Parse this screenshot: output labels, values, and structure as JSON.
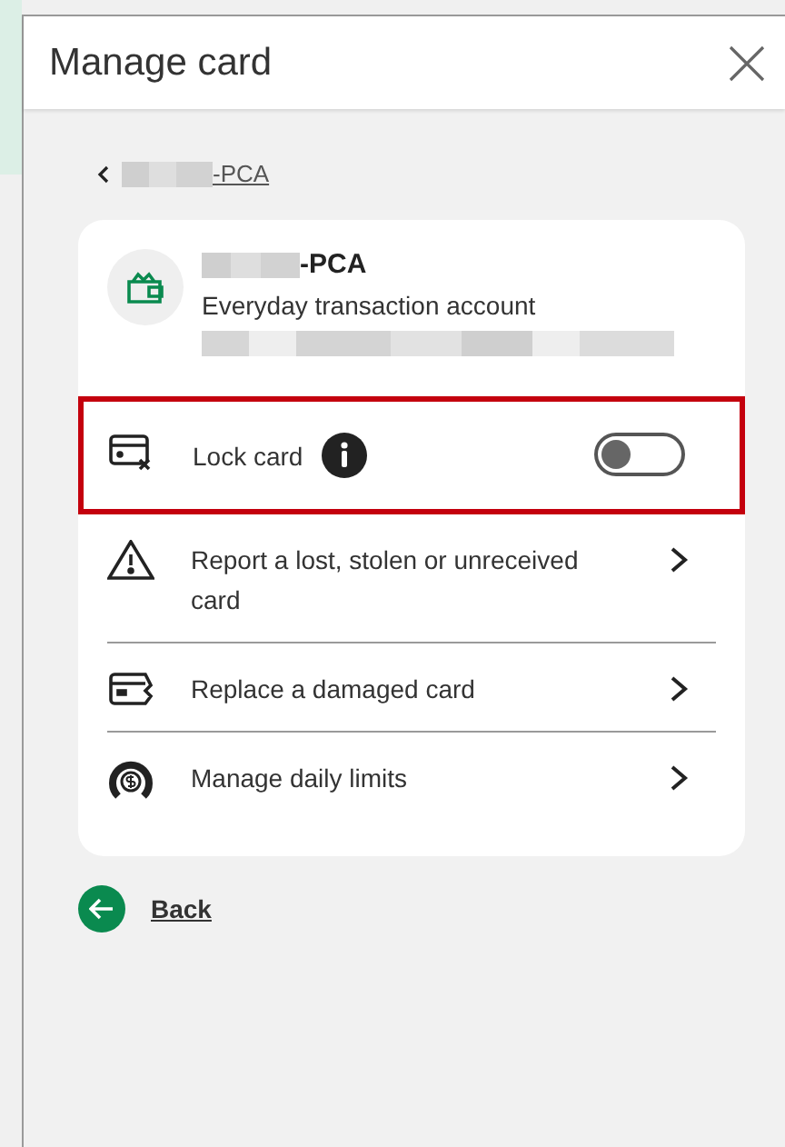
{
  "panel": {
    "title": "Manage card"
  },
  "breadcrumb": {
    "label": "-PCA"
  },
  "account": {
    "name": "-PCA",
    "type": "Everyday transaction account"
  },
  "actions": [
    {
      "kind": "toggle",
      "label": "Lock card",
      "on": false,
      "highlighted": true
    },
    {
      "kind": "link",
      "label": "Report a lost, stolen or unreceived card",
      "highlighted": false
    },
    {
      "kind": "link",
      "label": "Replace a damaged card",
      "highlighted": false
    },
    {
      "kind": "link",
      "label": "Manage daily limits",
      "highlighted": false
    }
  ],
  "back": {
    "label": "Back"
  }
}
